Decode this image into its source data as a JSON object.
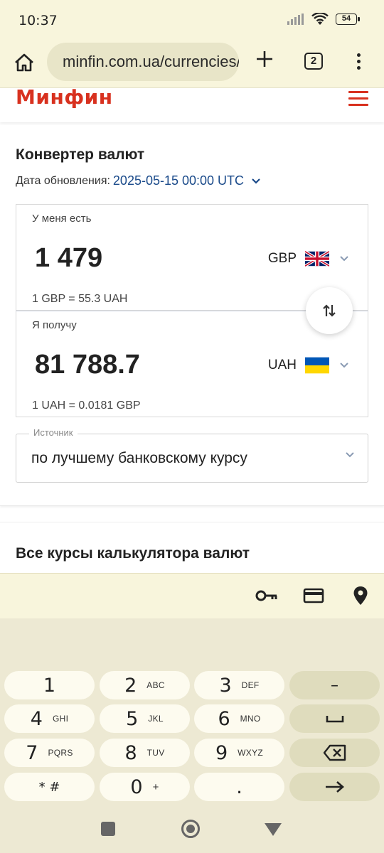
{
  "status": {
    "time": "10:37",
    "battery": "54"
  },
  "browser": {
    "url": "minfin.com.ua/currencies/converter",
    "tab_count": "2"
  },
  "site": {
    "logo": "Минфин"
  },
  "converter": {
    "title": "Конвертер валют",
    "update_label": "Дата обновления:",
    "update_date": "2025-05-15 00:00 UTC",
    "have": {
      "label": "У меня есть",
      "amount": "1 479",
      "currency": "GBP",
      "rate": "1 GBP = 55.3 UAH"
    },
    "get": {
      "label": "Я получу",
      "amount": "81 788.7",
      "currency": "UAH",
      "rate": "1 UAH = 0.0181 GBP"
    },
    "source": {
      "label": "Источник",
      "value": "по лучшему банковскому курсу"
    }
  },
  "all_rates": {
    "title": "Все курсы калькулятора валют"
  },
  "keyboard": {
    "keys": [
      {
        "num": "1",
        "sub": ""
      },
      {
        "num": "2",
        "sub": "ABC"
      },
      {
        "num": "3",
        "sub": "DEF"
      },
      {
        "num": "4",
        "sub": "GHI"
      },
      {
        "num": "5",
        "sub": "JKL"
      },
      {
        "num": "6",
        "sub": "MNO"
      },
      {
        "num": "7",
        "sub": "PQRS"
      },
      {
        "num": "8",
        "sub": "TUV"
      },
      {
        "num": "9",
        "sub": "WXYZ"
      },
      {
        "num": "* #",
        "sub": ""
      },
      {
        "num": "0",
        "sub": "+"
      },
      {
        "num": ".",
        "sub": ""
      }
    ],
    "minus": "–"
  },
  "colors": {
    "brand": "#d8311f",
    "link": "#1a4a8a",
    "keyboard_bg": "#ede9d3"
  }
}
